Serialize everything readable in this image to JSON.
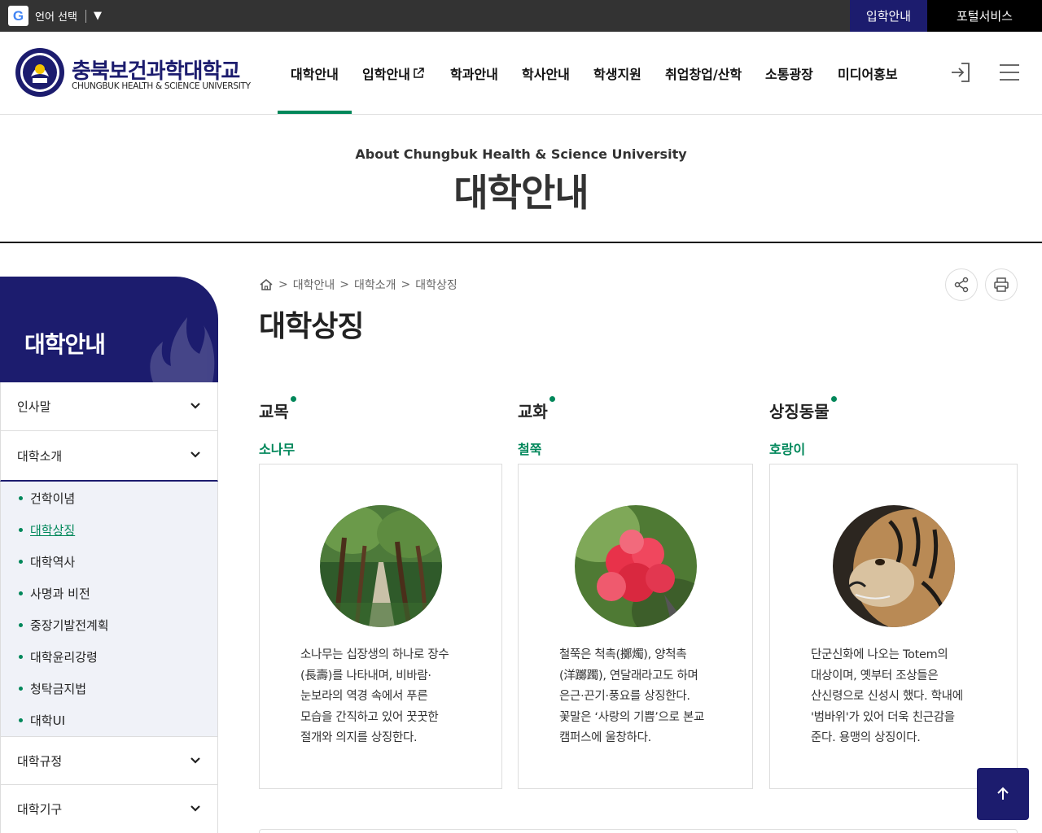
{
  "topbar": {
    "translate_icon": "google-g-icon",
    "translate_glyph": "G",
    "language_label": "언어 선택",
    "dropdown_glyph": "▼",
    "admission_label": "입학안내",
    "portal_label": "포털서비스"
  },
  "header": {
    "logo_kr": "충북보건과학대학교",
    "logo_en": "CHUNGBUK HEALTH & SCIENCE UNIVERSITY",
    "nav": [
      {
        "label": "대학안내",
        "active": true
      },
      {
        "label": "입학안내",
        "external": true
      },
      {
        "label": "학과안내"
      },
      {
        "label": "학사안내"
      },
      {
        "label": "학생지원"
      },
      {
        "label": "취업창업/산학"
      },
      {
        "label": "소통광장"
      },
      {
        "label": "미디어홍보"
      }
    ],
    "login_icon": "login-icon",
    "menu_icon": "hamburger-menu-icon"
  },
  "banner": {
    "subtitle": "About Chungbuk Health & Science University",
    "title": "대학안내"
  },
  "sidebar": {
    "title": "대학안내",
    "items": [
      {
        "label": "인사말"
      },
      {
        "label": "대학소개",
        "open": true
      },
      {
        "label": "대학규정"
      },
      {
        "label": "대학기구"
      }
    ],
    "sub_items": [
      {
        "label": "건학이념"
      },
      {
        "label": "대학상징",
        "current": true
      },
      {
        "label": "대학역사"
      },
      {
        "label": "사명과 비전"
      },
      {
        "label": "중장기발전계획"
      },
      {
        "label": "대학윤리강령"
      },
      {
        "label": "청탁금지법"
      },
      {
        "label": "대학UI"
      }
    ]
  },
  "breadcrumb": {
    "home_icon": "home-icon",
    "separator": ">",
    "items": [
      "대학안내",
      "대학소개",
      "대학상징"
    ]
  },
  "page": {
    "title": "대학상징",
    "share_icon": "share-icon",
    "print_icon": "print-icon"
  },
  "symbols": [
    {
      "heading": "교목",
      "name": "소나무",
      "image": "pine-tree-photo",
      "lines": [
        "소나무는 십장생의 하나로 장수",
        "(長壽)를 나타내며, 비바람·",
        "눈보라의 역경 속에서 푸른",
        "모습을 간직하고 있어 꿋꿋한",
        "절개와 의지를 상징한다."
      ]
    },
    {
      "heading": "교화",
      "name": "철쭉",
      "image": "azalea-flower-photo",
      "lines": [
        "철쭉은 척촉(擲燭), 양척촉",
        "(洋躑躅), 연달래라고도 하며",
        "은근·끈기·풍요를 상징한다.",
        "꽃말은 ‘사랑의 기쁨’으로 본교",
        "캠퍼스에 울창하다."
      ]
    },
    {
      "heading": "상징동물",
      "name": "호랑이",
      "image": "tiger-photo",
      "lines": [
        "단군신화에 나오는 Totem의",
        "대상이며, 옛부터 조상들은",
        "산신령으로 신성시 했다. 학내에",
        "'범바위'가 있어 더욱 친근감을",
        "준다. 용맹의 상징이다."
      ]
    }
  ],
  "to_top_icon": "arrow-up-icon",
  "colors": {
    "primary": "#1c1c6e",
    "accent": "#00875a",
    "topbar": "#333333"
  }
}
